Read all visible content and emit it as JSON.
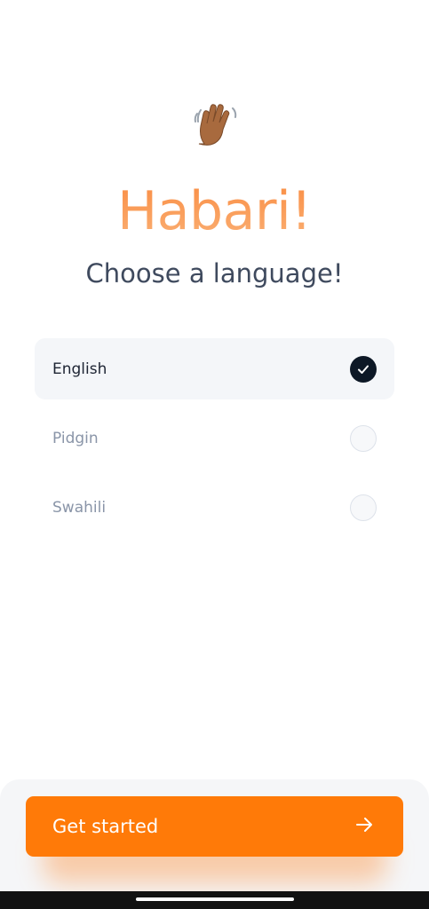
{
  "header": {
    "emoji_icon": "waving-hand-icon",
    "greeting": "Habari!",
    "subtitle": "Choose a language!"
  },
  "languages": [
    {
      "label": "English",
      "selected": true
    },
    {
      "label": "Pidgin",
      "selected": false
    },
    {
      "label": "Swahili",
      "selected": false
    }
  ],
  "cta": {
    "label": "Get started",
    "icon": "arrow-right-icon"
  },
  "colors": {
    "accent": "#ff7a08",
    "greeting_gradient": [
      "#f98c42",
      "#fbb176"
    ],
    "selected_row": "#f4f6f9",
    "check_fill": "#0d1826"
  }
}
